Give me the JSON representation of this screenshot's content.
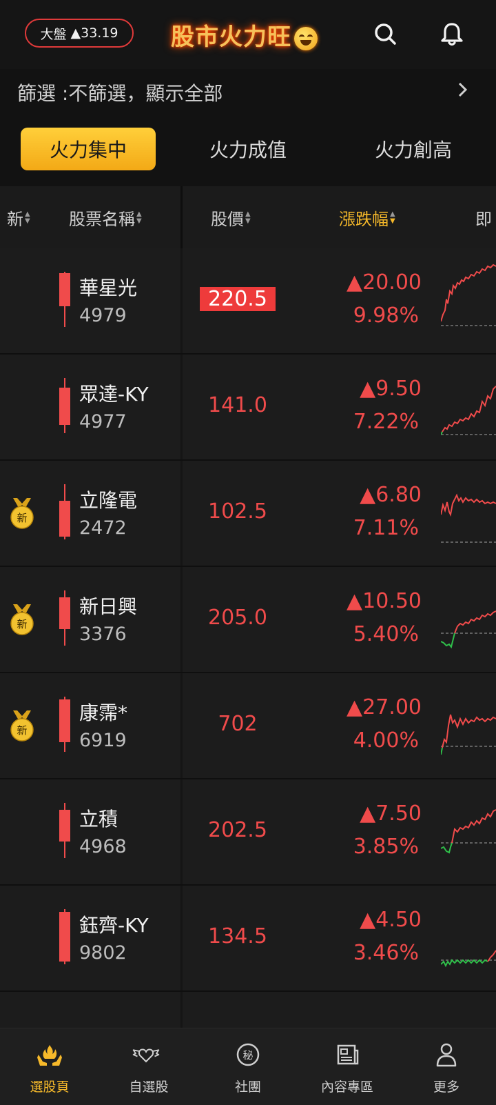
{
  "header": {
    "index_label": "大盤",
    "index_change": "▲33.19",
    "app_title": "股市火力旺"
  },
  "filter": {
    "label": "篩選 :不篩選，顯示全部"
  },
  "tabs": [
    {
      "label": "火力集中",
      "active": true
    },
    {
      "label": "火力成值",
      "active": false
    },
    {
      "label": "火力創高",
      "active": false
    }
  ],
  "columns": {
    "new": "新",
    "name": "股票名稱",
    "price": "股價",
    "change": "漲跌幅",
    "realtime": "即"
  },
  "new_badge": "新",
  "stocks": [
    {
      "name": "華星光",
      "code": "4979",
      "price": "220.5",
      "change": "▲20.00",
      "pct": "9.98%",
      "is_new": false,
      "price_highlight": true
    },
    {
      "name": "眾達-KY",
      "code": "4977",
      "price": "141.0",
      "change": "▲9.50",
      "pct": "7.22%",
      "is_new": false,
      "price_highlight": false
    },
    {
      "name": "立隆電",
      "code": "2472",
      "price": "102.5",
      "change": "▲6.80",
      "pct": "7.11%",
      "is_new": true,
      "price_highlight": false
    },
    {
      "name": "新日興",
      "code": "3376",
      "price": "205.0",
      "change": "▲10.50",
      "pct": "5.40%",
      "is_new": true,
      "price_highlight": false
    },
    {
      "name": "康霈*",
      "code": "6919",
      "price": "702",
      "change": "▲27.00",
      "pct": "4.00%",
      "is_new": true,
      "price_highlight": false
    },
    {
      "name": "立積",
      "code": "4968",
      "price": "202.5",
      "change": "▲7.50",
      "pct": "3.85%",
      "is_new": false,
      "price_highlight": false
    },
    {
      "name": "鈺齊-KY",
      "code": "9802",
      "price": "134.5",
      "change": "▲4.50",
      "pct": "3.46%",
      "is_new": false,
      "price_highlight": false
    }
  ],
  "bottom_nav": [
    {
      "label": "選股頁",
      "icon": "fire-hands-icon",
      "active": true
    },
    {
      "label": "自選股",
      "icon": "winged-heart-icon",
      "active": false
    },
    {
      "label": "社團",
      "icon": "secret-badge-icon",
      "active": false
    },
    {
      "label": "內容專區",
      "icon": "newspaper-icon",
      "active": false
    },
    {
      "label": "更多",
      "icon": "person-icon",
      "active": false
    }
  ],
  "colors": {
    "up": "#f04b4b",
    "down": "#2fbf4a",
    "accent": "#f6b92a",
    "background": "#121212"
  }
}
